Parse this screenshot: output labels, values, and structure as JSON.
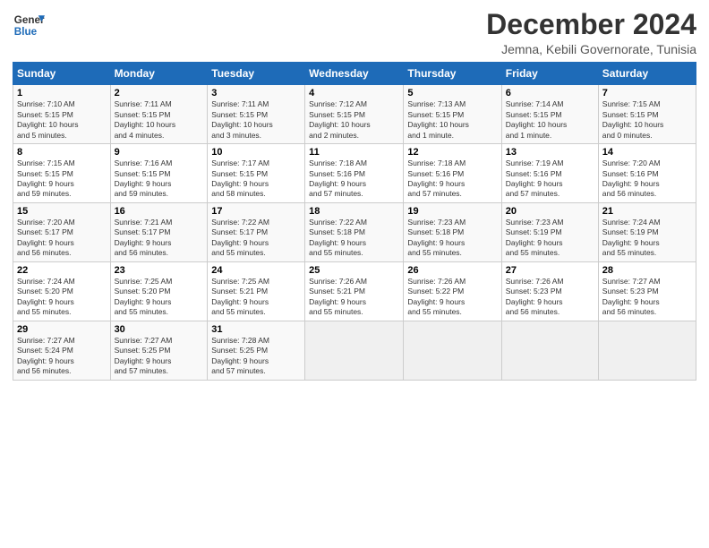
{
  "header": {
    "logo_line1": "General",
    "logo_line2": "Blue",
    "month": "December 2024",
    "location": "Jemna, Kebili Governorate, Tunisia"
  },
  "days_of_week": [
    "Sunday",
    "Monday",
    "Tuesday",
    "Wednesday",
    "Thursday",
    "Friday",
    "Saturday"
  ],
  "weeks": [
    [
      {
        "day": "1",
        "info": "Sunrise: 7:10 AM\nSunset: 5:15 PM\nDaylight: 10 hours\nand 5 minutes."
      },
      {
        "day": "2",
        "info": "Sunrise: 7:11 AM\nSunset: 5:15 PM\nDaylight: 10 hours\nand 4 minutes."
      },
      {
        "day": "3",
        "info": "Sunrise: 7:11 AM\nSunset: 5:15 PM\nDaylight: 10 hours\nand 3 minutes."
      },
      {
        "day": "4",
        "info": "Sunrise: 7:12 AM\nSunset: 5:15 PM\nDaylight: 10 hours\nand 2 minutes."
      },
      {
        "day": "5",
        "info": "Sunrise: 7:13 AM\nSunset: 5:15 PM\nDaylight: 10 hours\nand 1 minute."
      },
      {
        "day": "6",
        "info": "Sunrise: 7:14 AM\nSunset: 5:15 PM\nDaylight: 10 hours\nand 1 minute."
      },
      {
        "day": "7",
        "info": "Sunrise: 7:15 AM\nSunset: 5:15 PM\nDaylight: 10 hours\nand 0 minutes."
      }
    ],
    [
      {
        "day": "8",
        "info": "Sunrise: 7:15 AM\nSunset: 5:15 PM\nDaylight: 9 hours\nand 59 minutes."
      },
      {
        "day": "9",
        "info": "Sunrise: 7:16 AM\nSunset: 5:15 PM\nDaylight: 9 hours\nand 59 minutes."
      },
      {
        "day": "10",
        "info": "Sunrise: 7:17 AM\nSunset: 5:15 PM\nDaylight: 9 hours\nand 58 minutes."
      },
      {
        "day": "11",
        "info": "Sunrise: 7:18 AM\nSunset: 5:16 PM\nDaylight: 9 hours\nand 57 minutes."
      },
      {
        "day": "12",
        "info": "Sunrise: 7:18 AM\nSunset: 5:16 PM\nDaylight: 9 hours\nand 57 minutes."
      },
      {
        "day": "13",
        "info": "Sunrise: 7:19 AM\nSunset: 5:16 PM\nDaylight: 9 hours\nand 57 minutes."
      },
      {
        "day": "14",
        "info": "Sunrise: 7:20 AM\nSunset: 5:16 PM\nDaylight: 9 hours\nand 56 minutes."
      }
    ],
    [
      {
        "day": "15",
        "info": "Sunrise: 7:20 AM\nSunset: 5:17 PM\nDaylight: 9 hours\nand 56 minutes."
      },
      {
        "day": "16",
        "info": "Sunrise: 7:21 AM\nSunset: 5:17 PM\nDaylight: 9 hours\nand 56 minutes."
      },
      {
        "day": "17",
        "info": "Sunrise: 7:22 AM\nSunset: 5:17 PM\nDaylight: 9 hours\nand 55 minutes."
      },
      {
        "day": "18",
        "info": "Sunrise: 7:22 AM\nSunset: 5:18 PM\nDaylight: 9 hours\nand 55 minutes."
      },
      {
        "day": "19",
        "info": "Sunrise: 7:23 AM\nSunset: 5:18 PM\nDaylight: 9 hours\nand 55 minutes."
      },
      {
        "day": "20",
        "info": "Sunrise: 7:23 AM\nSunset: 5:19 PM\nDaylight: 9 hours\nand 55 minutes."
      },
      {
        "day": "21",
        "info": "Sunrise: 7:24 AM\nSunset: 5:19 PM\nDaylight: 9 hours\nand 55 minutes."
      }
    ],
    [
      {
        "day": "22",
        "info": "Sunrise: 7:24 AM\nSunset: 5:20 PM\nDaylight: 9 hours\nand 55 minutes."
      },
      {
        "day": "23",
        "info": "Sunrise: 7:25 AM\nSunset: 5:20 PM\nDaylight: 9 hours\nand 55 minutes."
      },
      {
        "day": "24",
        "info": "Sunrise: 7:25 AM\nSunset: 5:21 PM\nDaylight: 9 hours\nand 55 minutes."
      },
      {
        "day": "25",
        "info": "Sunrise: 7:26 AM\nSunset: 5:21 PM\nDaylight: 9 hours\nand 55 minutes."
      },
      {
        "day": "26",
        "info": "Sunrise: 7:26 AM\nSunset: 5:22 PM\nDaylight: 9 hours\nand 55 minutes."
      },
      {
        "day": "27",
        "info": "Sunrise: 7:26 AM\nSunset: 5:23 PM\nDaylight: 9 hours\nand 56 minutes."
      },
      {
        "day": "28",
        "info": "Sunrise: 7:27 AM\nSunset: 5:23 PM\nDaylight: 9 hours\nand 56 minutes."
      }
    ],
    [
      {
        "day": "29",
        "info": "Sunrise: 7:27 AM\nSunset: 5:24 PM\nDaylight: 9 hours\nand 56 minutes."
      },
      {
        "day": "30",
        "info": "Sunrise: 7:27 AM\nSunset: 5:25 PM\nDaylight: 9 hours\nand 57 minutes."
      },
      {
        "day": "31",
        "info": "Sunrise: 7:28 AM\nSunset: 5:25 PM\nDaylight: 9 hours\nand 57 minutes."
      },
      null,
      null,
      null,
      null
    ]
  ]
}
